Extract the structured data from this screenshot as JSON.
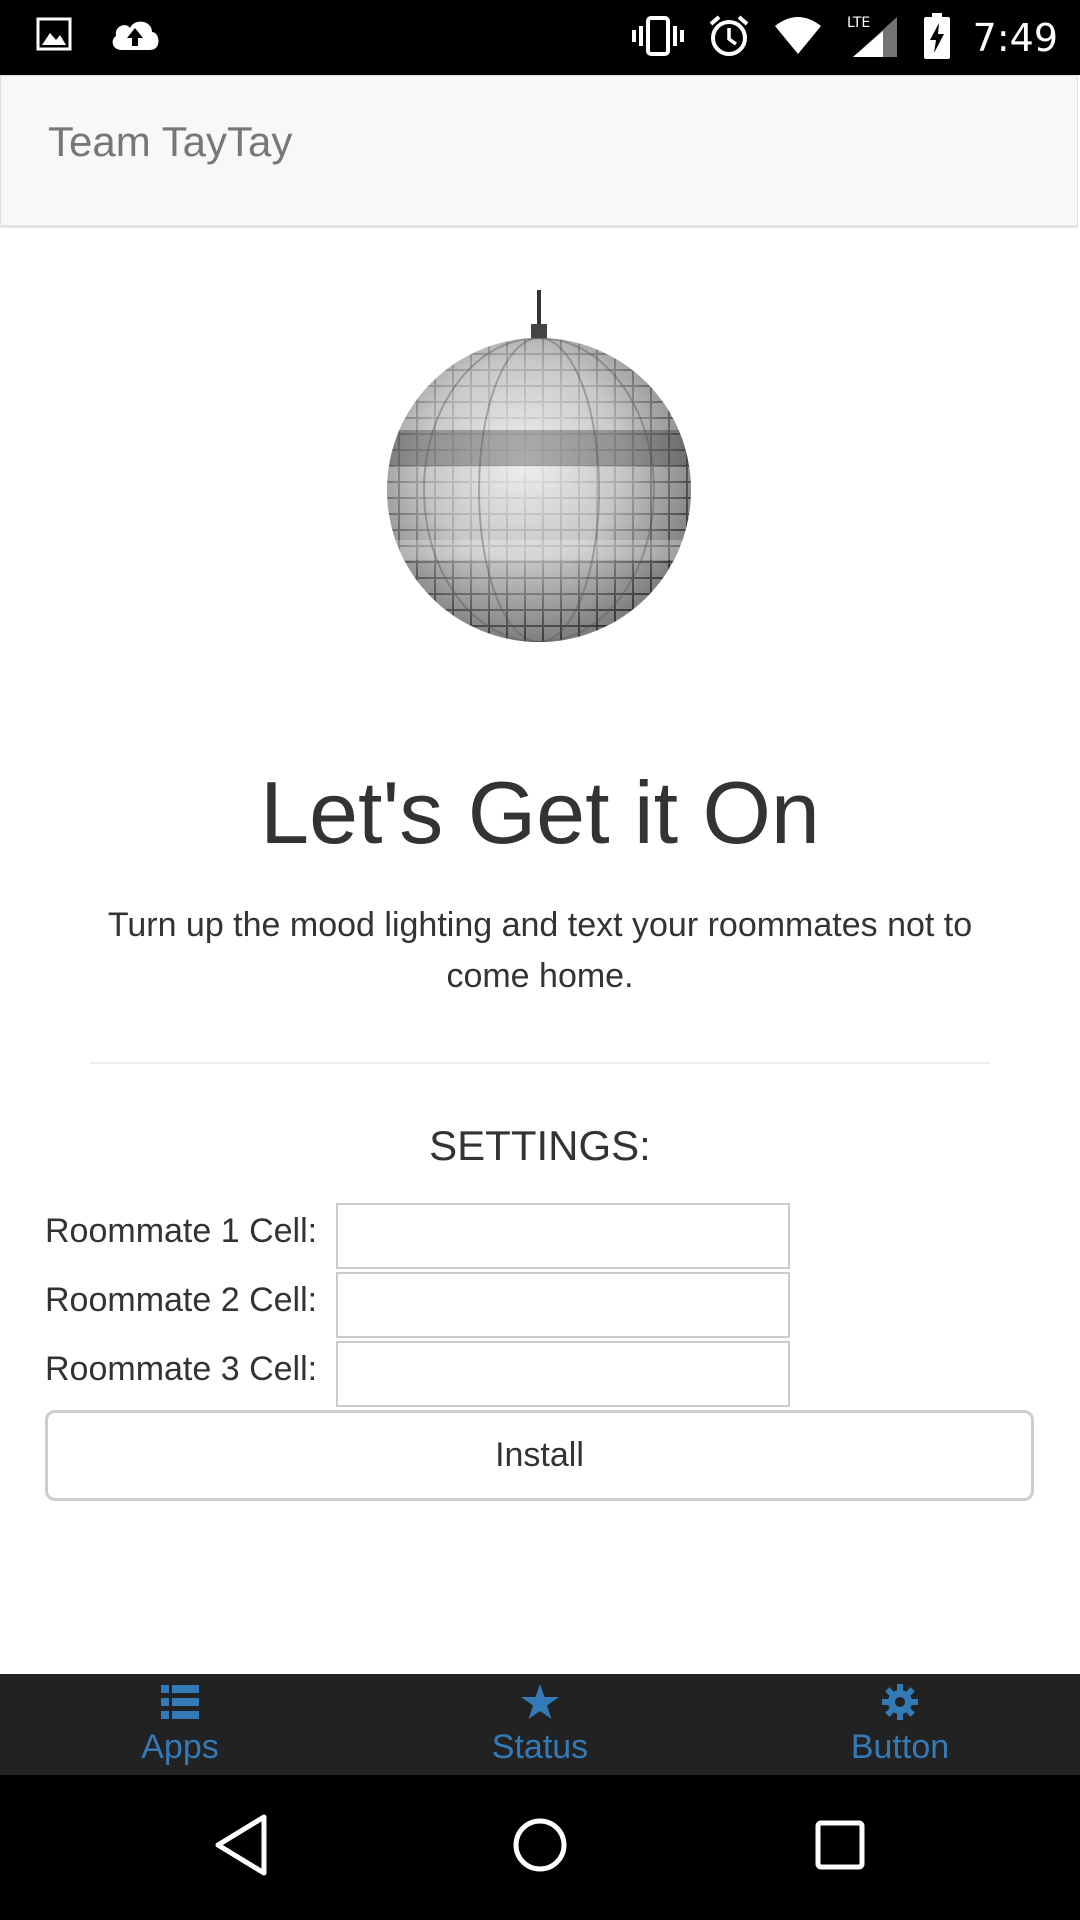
{
  "status_bar": {
    "time": "7:49",
    "left_icons": [
      "image-icon",
      "cloud-upload-icon"
    ],
    "right_icons": [
      "vibrate-icon",
      "alarm-icon",
      "wifi-icon",
      "lte-signal-icon",
      "battery-charging-icon"
    ],
    "network_label": "LTE"
  },
  "header": {
    "title": "Team TayTay"
  },
  "hero": {
    "image": "disco-ball-image",
    "headline": "Let's Get it On",
    "description": "Turn up the mood lighting and text your roommates not to come home."
  },
  "settings": {
    "title": "SETTINGS:",
    "fields": [
      {
        "label": "Roommate 1 Cell:",
        "value": ""
      },
      {
        "label": "Roommate 2 Cell:",
        "value": ""
      },
      {
        "label": "Roommate 3 Cell:",
        "value": ""
      }
    ],
    "install_label": "Install"
  },
  "tabbar": {
    "accent_color": "#337ab7",
    "background_color": "#222222",
    "tabs": [
      {
        "label": "Apps",
        "icon": "list-icon"
      },
      {
        "label": "Status",
        "icon": "star-icon"
      },
      {
        "label": "Button",
        "icon": "gear-icon"
      }
    ]
  },
  "nav_bar": {
    "buttons": [
      "back-icon",
      "home-icon",
      "recents-icon"
    ]
  }
}
